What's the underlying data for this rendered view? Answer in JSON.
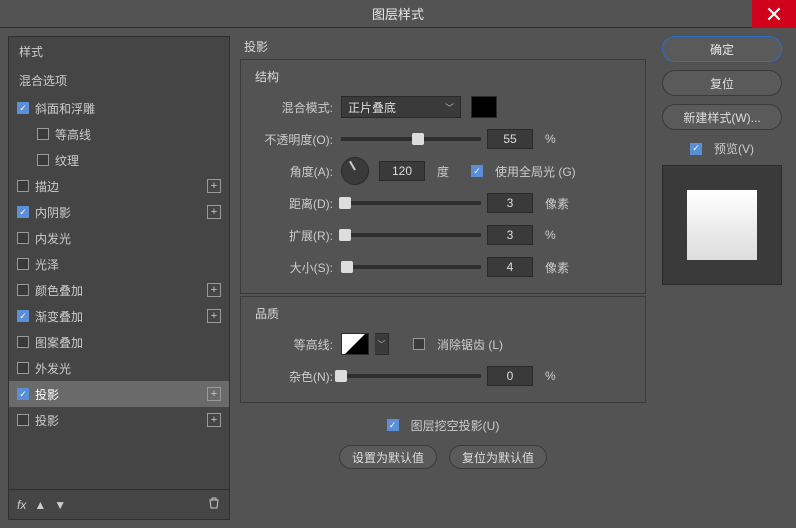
{
  "window": {
    "title": "图层样式"
  },
  "left": {
    "styles_header": "样式",
    "blend_options": "混合选项",
    "items": [
      {
        "label": "斜面和浮雕",
        "checked": true,
        "plus": false,
        "sub": false
      },
      {
        "label": "等高线",
        "checked": false,
        "plus": false,
        "sub": true
      },
      {
        "label": "纹理",
        "checked": false,
        "plus": false,
        "sub": true
      },
      {
        "label": "描边",
        "checked": false,
        "plus": true,
        "sub": false
      },
      {
        "label": "内阴影",
        "checked": true,
        "plus": true,
        "sub": false
      },
      {
        "label": "内发光",
        "checked": false,
        "plus": false,
        "sub": false
      },
      {
        "label": "光泽",
        "checked": false,
        "plus": false,
        "sub": false
      },
      {
        "label": "颜色叠加",
        "checked": false,
        "plus": true,
        "sub": false
      },
      {
        "label": "渐变叠加",
        "checked": true,
        "plus": true,
        "sub": false
      },
      {
        "label": "图案叠加",
        "checked": false,
        "plus": false,
        "sub": false
      },
      {
        "label": "外发光",
        "checked": false,
        "plus": false,
        "sub": false
      },
      {
        "label": "投影",
        "checked": true,
        "plus": true,
        "sub": false,
        "selected": true
      },
      {
        "label": "投影",
        "checked": false,
        "plus": true,
        "sub": false
      }
    ],
    "fx": "fx"
  },
  "mid": {
    "title": "投影",
    "structure": {
      "legend": "结构",
      "blend_mode_label": "混合模式:",
      "blend_mode_value": "正片叠底",
      "opacity_label": "不透明度(O):",
      "opacity_value": "55",
      "opacity_unit": "%",
      "angle_label": "角度(A):",
      "angle_value": "120",
      "angle_unit": "度",
      "global_light_label": "使用全局光 (G)",
      "distance_label": "距离(D):",
      "distance_value": "3",
      "distance_unit": "像素",
      "spread_label": "扩展(R):",
      "spread_value": "3",
      "spread_unit": "%",
      "size_label": "大小(S):",
      "size_value": "4",
      "size_unit": "像素"
    },
    "quality": {
      "legend": "品质",
      "contour_label": "等高线:",
      "antialias_label": "消除锯齿 (L)",
      "noise_label": "杂色(N):",
      "noise_value": "0",
      "noise_unit": "%"
    },
    "knockout_label": "图层挖空投影(U)",
    "make_default": "设置为默认值",
    "reset_default": "复位为默认值"
  },
  "right": {
    "ok": "确定",
    "cancel": "复位",
    "new_style": "新建样式(W)...",
    "preview_label": "预览(V)"
  }
}
